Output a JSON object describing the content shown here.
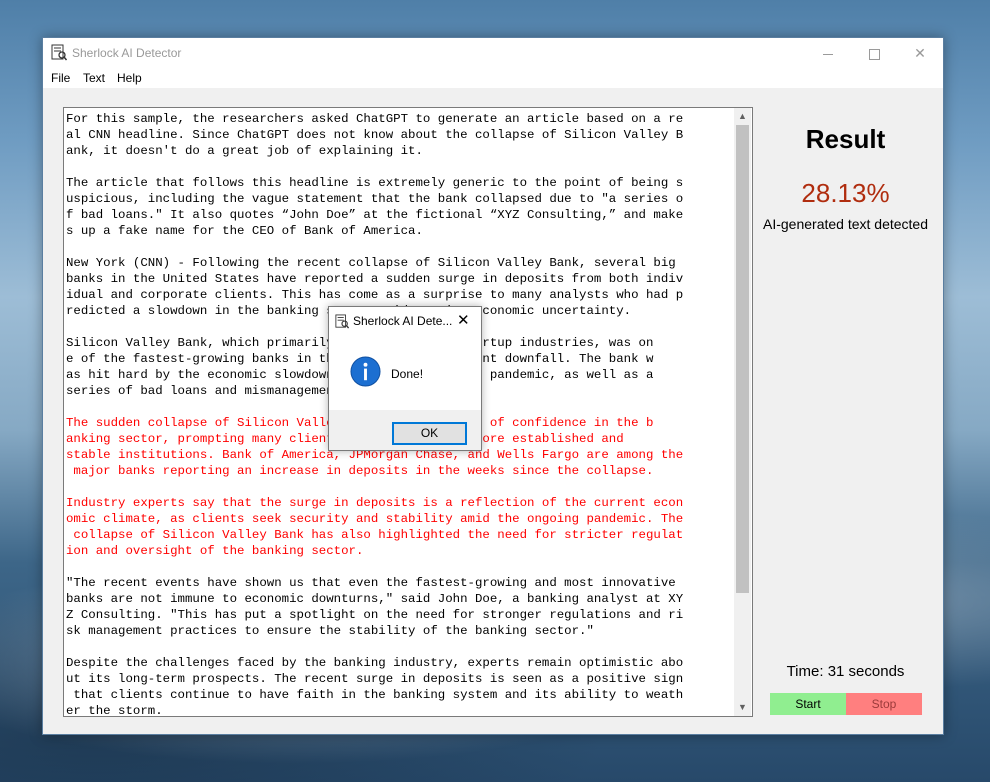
{
  "window": {
    "title": "Sherlock AI Detector",
    "controls": {
      "minimize": "minimize",
      "maximize": "maximize",
      "close": "✕"
    }
  },
  "menu": {
    "file": "File",
    "text": "Text",
    "help": "Help"
  },
  "text_area": {
    "lines": [
      {
        "text": "For this sample, the researchers asked ChatGPT to generate an article based on a re",
        "red": false
      },
      {
        "text": "al CNN headline. Since ChatGPT does not know about the collapse of Silicon Valley B",
        "red": false
      },
      {
        "text": "ank, it doesn't do a great job of explaining it.",
        "red": false
      },
      {
        "text": "",
        "red": false
      },
      {
        "text": "The article that follows this headline is extremely generic to the point of being s",
        "red": false
      },
      {
        "text": "uspicious, including the vague statement that the bank collapsed due to \"a series o",
        "red": false
      },
      {
        "text": "f bad loans.\" It also quotes “John Doe” at the fictional “XYZ Consulting,” and make",
        "red": false
      },
      {
        "text": "s up a fake name for the CEO of Bank of America.",
        "red": false
      },
      {
        "text": "",
        "red": false
      },
      {
        "text": "New York (CNN) - Following the recent collapse of Silicon Valley Bank, several big",
        "red": false
      },
      {
        "text": "banks in the United States have reported a sudden surge in deposits from both indiv",
        "red": false
      },
      {
        "text": "idual and corporate clients. This has come as a surprise to many analysts who had p",
        "red": false
      },
      {
        "text": "redicted a slowdown in the banking sector amid ongoing economic uncertainty.",
        "red": false
      },
      {
        "text": "",
        "red": false
      },
      {
        "text": "Silicon Valley Bank, which primarily served tech and startup industries, was on",
        "red": false
      },
      {
        "text": "e of the fastest-growing banks in the US before its recent downfall. The bank w",
        "red": false
      },
      {
        "text": "as hit hard by the economic slowdown due to the COVID-19 pandemic, as well as a",
        "red": false
      },
      {
        "text": "series of bad loans and mismanagement.",
        "red": false
      },
      {
        "text": "",
        "red": false
      },
      {
        "text": "The sudden collapse of Silicon Valley Bank led to a loss of confidence in the b",
        "red": true
      },
      {
        "text": "anking sector, prompting many clients to move funds to more established and",
        "red": true
      },
      {
        "text": "stable institutions. Bank of America, JPMorgan Chase, and Wells Fargo are among the",
        "red": true
      },
      {
        "text": " major banks reporting an increase in deposits in the weeks since the collapse.",
        "red": true
      },
      {
        "text": "",
        "red": false
      },
      {
        "text": "Industry experts say that the surge in deposits is a reflection of the current econ",
        "red": true
      },
      {
        "text": "omic climate, as clients seek security and stability amid the ongoing pandemic. The",
        "red": true
      },
      {
        "text": " collapse of Silicon Valley Bank has also highlighted the need for stricter regulat",
        "red": true
      },
      {
        "text": "ion and oversight of the banking sector.",
        "red": true
      },
      {
        "text": "",
        "red": false
      },
      {
        "text": "\"The recent events have shown us that even the fastest-growing and most innovative",
        "red": false
      },
      {
        "text": "banks are not immune to economic downturns,\" said John Doe, a banking analyst at XY",
        "red": false
      },
      {
        "text": "Z Consulting. \"This has put a spotlight on the need for stronger regulations and ri",
        "red": false
      },
      {
        "text": "sk management practices to ensure the stability of the banking sector.\"",
        "red": false
      },
      {
        "text": "",
        "red": false
      },
      {
        "text": "Despite the challenges faced by the banking industry, experts remain optimistic abo",
        "red": false
      },
      {
        "text": "ut its long-term prospects. The recent surge in deposits is seen as a positive sign",
        "red": false
      },
      {
        "text": " that clients continue to have faith in the banking system and its ability to weath",
        "red": false
      },
      {
        "text": "er the storm.",
        "red": false
      }
    ]
  },
  "result": {
    "heading": "Result",
    "percentage": "28.13%",
    "description": "AI-generated text detected",
    "percentage_color": "#b02d0f"
  },
  "timer": {
    "label": "Time: 31 seconds"
  },
  "buttons": {
    "start": "Start",
    "stop": "Stop",
    "start_color": "#90ee90",
    "stop_color": "#ff7f7f"
  },
  "dialog": {
    "title": "Sherlock AI Dete...",
    "message": "Done!",
    "ok": "OK",
    "close": "✕",
    "icon": "info-icon"
  }
}
